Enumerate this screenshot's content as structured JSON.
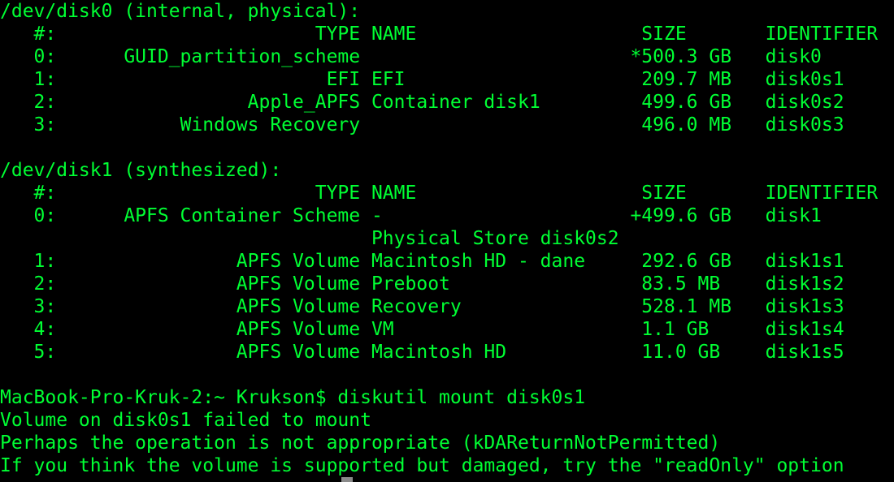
{
  "colors": {
    "background": "#000000",
    "text": "#00ff33",
    "cursor": "#8a8a8a"
  },
  "lines": [
    "/dev/disk0 (internal, physical):",
    "   #:                       TYPE NAME                    SIZE       IDENTIFIER",
    "   0:      GUID_partition_scheme                        *500.3 GB   disk0",
    "   1:                        EFI EFI                     209.7 MB   disk0s1",
    "   2:                 Apple_APFS Container disk1         499.6 GB   disk0s2",
    "   3:           Windows Recovery                         496.0 MB   disk0s3",
    "",
    "/dev/disk1 (synthesized):",
    "   #:                       TYPE NAME                    SIZE       IDENTIFIER",
    "   0:      APFS Container Scheme -                      +499.6 GB   disk1",
    "                                 Physical Store disk0s2",
    "   1:                APFS Volume Macintosh HD - dane     292.6 GB   disk1s1",
    "   2:                APFS Volume Preboot                 83.5 MB    disk1s2",
    "   3:                APFS Volume Recovery                528.1 MB   disk1s3",
    "   4:                APFS Volume VM                      1.1 GB     disk1s4",
    "   5:                APFS Volume Macintosh HD            11.0 GB    disk1s5",
    "",
    "MacBook-Pro-Kruk-2:~ Krukson$ diskutil mount disk0s1",
    "Volume on disk0s1 failed to mount",
    "Perhaps the operation is not appropriate (kDAReturnNotPermitted)",
    "If you think the volume is supported but damaged, try the \"readOnly\" option"
  ]
}
